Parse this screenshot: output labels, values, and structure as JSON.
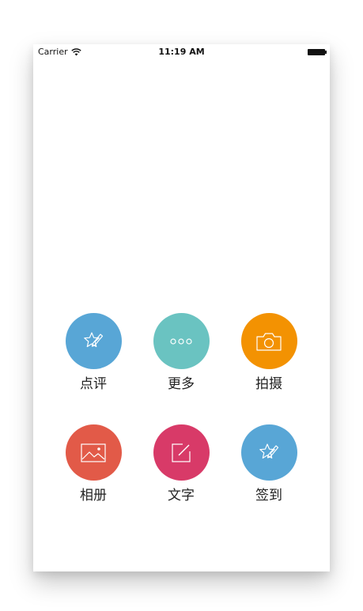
{
  "status_bar": {
    "carrier": "Carrier",
    "time": "11:19 AM"
  },
  "actions": [
    {
      "label": "点评",
      "icon": "review-star-pen-icon",
      "color": "#58a6d6"
    },
    {
      "label": "更多",
      "icon": "more-dots-icon",
      "color": "#6ac3c1"
    },
    {
      "label": "拍摄",
      "icon": "camera-icon",
      "color": "#f39202"
    },
    {
      "label": "相册",
      "icon": "photo-album-icon",
      "color": "#e25a48"
    },
    {
      "label": "文字",
      "icon": "compose-text-icon",
      "color": "#d83a68"
    },
    {
      "label": "签到",
      "icon": "checkin-star-pen-icon",
      "color": "#58a6d6"
    }
  ]
}
